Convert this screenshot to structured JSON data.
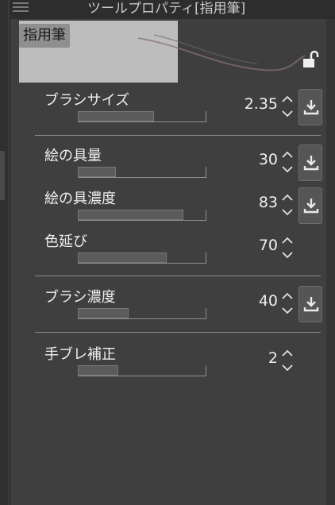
{
  "panel": {
    "title": "ツールプロパティ[指用筆]",
    "tool_tag": "指用筆"
  },
  "properties": [
    {
      "label": "ブラシサイズ",
      "value": "2.35",
      "level": 0.6,
      "has_button": true
    },
    {
      "label": "絵の具量",
      "value": "30",
      "level": 0.3,
      "has_button": true
    },
    {
      "label": "絵の具濃度",
      "value": "83",
      "level": 0.83,
      "has_button": true
    },
    {
      "label": "色延び",
      "value": "70",
      "level": 0.7,
      "has_button": false
    },
    {
      "label": "ブラシ濃度",
      "value": "40",
      "level": 0.4,
      "has_button": true
    },
    {
      "label": "手ブレ補正",
      "value": "2",
      "level": 0.32,
      "has_button": false
    }
  ],
  "icons": {
    "menu": "hamburger-menu-icon",
    "lock": "unlock-icon",
    "spin": "up-down-chevron-icon",
    "download": "download-icon"
  }
}
